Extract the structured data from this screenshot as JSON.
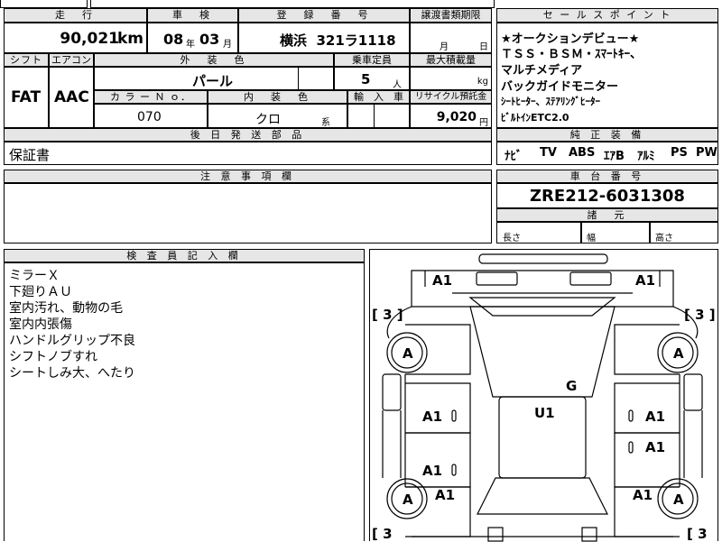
{
  "labels": {
    "mileage": "走　行",
    "inspection": "車　検",
    "registration": "登　録　番　号",
    "transfer_deadline": "譲渡書類期限",
    "sales_points": "セ ー ル ス ポ イ ン ト",
    "shift": "シフト",
    "aircon": "エアコン",
    "exterior_color": "外　装　色",
    "capacity": "乗車定員",
    "max_load": "最大積載量",
    "color_no": "カ ラ ー Ｎ ｏ．",
    "interior_color": "内　装　色",
    "import": "輸　入　車",
    "recycle": "リサイクル預託金",
    "genuine_equipment": "純 正 装 備",
    "later_parts": "後 日 発 送 部 品",
    "caution": "注 意 事 項 欄",
    "chassis_number": "車 台 番 号",
    "specs": "諸　元",
    "length": "長さ",
    "width": "幅",
    "height": "高さ",
    "inspector_notes": "検 査 員 記 入 欄"
  },
  "values": {
    "mileage": "90,021",
    "mileage_unit": "km",
    "inspection_year": "08",
    "year_unit": "年",
    "inspection_month": "03",
    "month_unit": "月",
    "registration": "横浜  321ラ1118",
    "transfer_month_unit": "月",
    "transfer_day_unit": "日",
    "shift": "FAT",
    "aircon": "AAC",
    "exterior_color": "パール",
    "capacity": "5",
    "capacity_unit": "人",
    "max_load_unit": "kg",
    "color_no": "070",
    "interior_color": "クロ",
    "interior_suffix": "系",
    "recycle": "9,020",
    "recycle_unit": "円",
    "later_parts": "保証書",
    "chassis_number": "ZRE212-6031308"
  },
  "sales_points": [
    "★オークションデビュー★",
    "ＴＳＳ・ＢＳＭ・ｽﾏｰﾄｷｰ、",
    "マルチメディア",
    "バックガイドモニター",
    "ｼｰﾄﾋｰﾀｰ、ｽﾃｱﾘﾝｸﾞﾋｰﾀｰ",
    "ﾋﾞﾙﾄｲﾝETC2.0"
  ],
  "equipment": [
    "ﾅﾋﾞ",
    "TV",
    "ABS",
    "ｴｱB",
    "ｱﾙﾐ",
    "PS",
    "PW"
  ],
  "inspector_notes": [
    "ミラーＸ",
    "下廻りＡＵ",
    "室内汚れ、動物の毛",
    "室内内張傷",
    "ハンドルグリップ不良",
    "シフトノブすれ",
    "シートしみ大、へたり"
  ],
  "diagram": {
    "front_left": "A1",
    "front_right": "A1",
    "tire_fl": "A",
    "tire_fr": "A",
    "tire_rl": "A",
    "tire_rr": "A",
    "depth_fl": "[ 3 ]",
    "depth_fr": "[ 3 ]",
    "depth_rl": "[ 3",
    "depth_rr": "[ 3",
    "center": "U1",
    "center_g": "G",
    "door_fl": "A1",
    "door_rl": "A1",
    "door_fr": "A1",
    "door_rr": "A1",
    "rear_left": "A1",
    "rear_right": "A1"
  }
}
